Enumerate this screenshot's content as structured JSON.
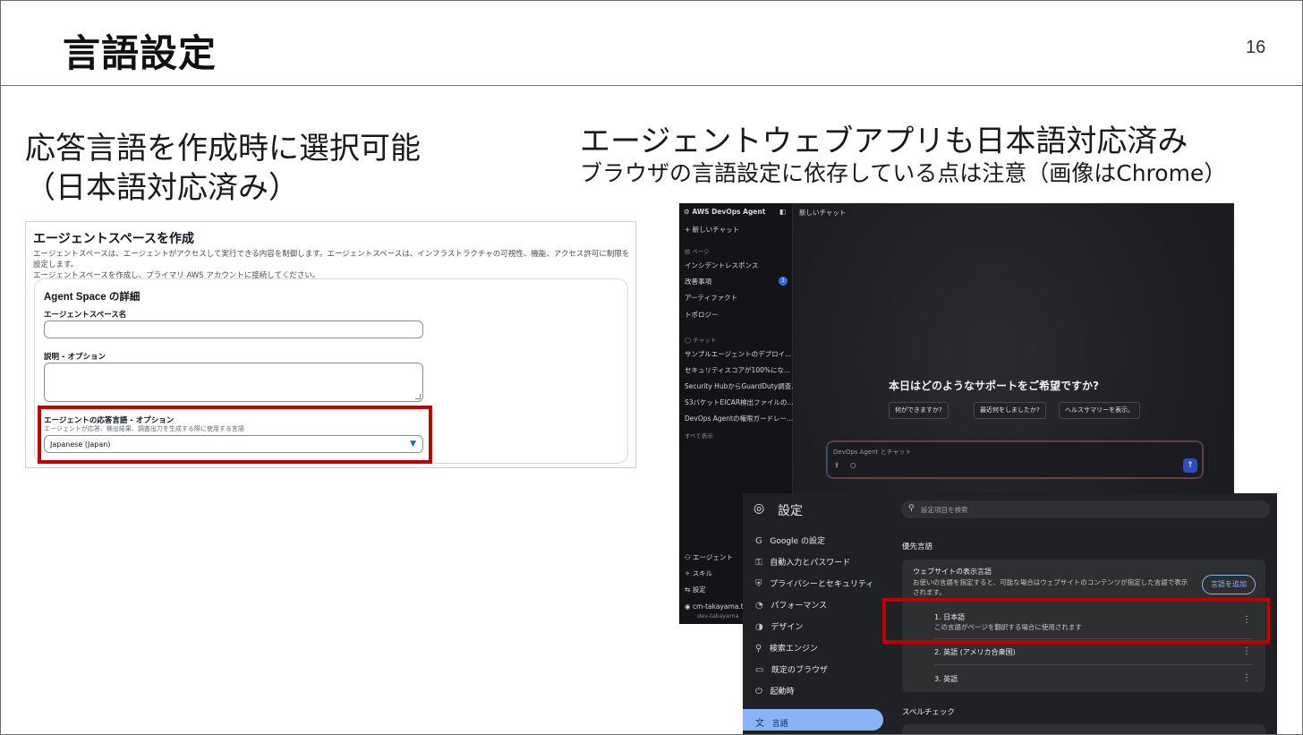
{
  "slide": {
    "title": "言語設定",
    "page_number": "16"
  },
  "left": {
    "heading_line1": "応答言語を作成時に選択可能",
    "heading_line2": "（日本語対応済み）"
  },
  "right": {
    "heading": "エージェントウェブアプリも日本語対応済み",
    "subheading": "ブラウザの言語設定に依存している点は注意（画像はChrome）"
  },
  "form": {
    "title": "エージェントスペースを作成",
    "desc_line1": "エージェントスペースは、エージェントがアクセスして実行できる内容を制御します。エージェントスペースは、インフラストラクチャの可視性、機能、アクセス許可に制限を設定します。",
    "desc_line2": "エージェントスペースを作成し、プライマリ AWS アカウントに接続してください。",
    "card_title": "Agent Space の詳細",
    "name_label": "エージェントスペース名",
    "desc_label": "説明 - オプション",
    "lang_label": "エージェントの応答言語 - オプション",
    "lang_hint": "エージェントが応答、検出結果、調査出力を生成する際に使用する言語",
    "lang_value": "Japanese (Japan)",
    "caret": "▼"
  },
  "agent": {
    "brand": "AWS DevOps Agent",
    "new_chat": "+ 新しいチャット",
    "header_title": "新しいチャット",
    "pages_label": "ページ",
    "pages": [
      "インシデントレスポンス",
      "改善事項",
      "アーティファクト",
      "トポロジー"
    ],
    "badge": "1",
    "chat_label": "チャット",
    "chats": [
      "サンプルエージェントのデプロイ...",
      "セキュリティスコアが100%にな...",
      "Security HubからGuardDuty調査...",
      "S3バケットEICAR検出ファイルの...",
      "DevOps Agentの権限ガードレー..."
    ],
    "show_all": "すべて表示",
    "bottom": [
      "エージェント",
      "スキル",
      "設定"
    ],
    "user_name": "cm-takayama.t",
    "user_space": "dev-takayama",
    "question": "本日はどのようなサポートをご希望ですか?",
    "chips": [
      "何ができますか?",
      "最近何をしましたか?",
      "ヘルスサマリーを表示。"
    ],
    "chat_placeholder": "DevOps Agent とチャット",
    "send": "↑"
  },
  "chrome": {
    "title": "設定",
    "search_placeholder": "設定項目を検索",
    "nav": [
      "Google の設定",
      "自動入力とパスワード",
      "プライバシーとセキュリティ",
      "パフォーマンス",
      "デザイン",
      "検索エンジン",
      "既定のブラウザ",
      "起動時",
      "言語"
    ],
    "nav_icons": [
      "G",
      "⚿",
      "⛨",
      "◔",
      "◑",
      "⚲",
      "▭",
      "⏻",
      "文"
    ],
    "section_preferred": "優先言語",
    "display_title": "ウェブサイトの表示言語",
    "display_desc_line1": "お使いの言語を指定すると、可能な場合はウェブサイトのコンテンツが指定した言語で表示",
    "display_desc_line2": "されます。",
    "add_language": "言語を追加",
    "languages": [
      {
        "name": "1. 日本語",
        "desc": "この言語がページを翻訳する場合に使用されます"
      },
      {
        "name": "2. 英語 (アメリカ合衆国)",
        "desc": ""
      },
      {
        "name": "3. 英語",
        "desc": ""
      }
    ],
    "section_spell": "スペルチェック",
    "kebab": "⋮"
  },
  "colors": {
    "highlight_red": "#c00000",
    "aws_blue": "#0972d3",
    "chrome_accent": "#8ab4f8"
  }
}
